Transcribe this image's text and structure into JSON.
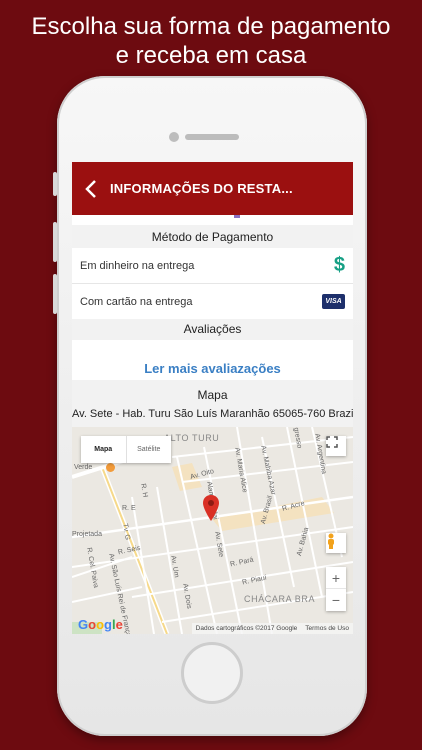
{
  "headline": {
    "line1": "Escolha sua forma de pagamento",
    "line2": "e receba em casa"
  },
  "appbar": {
    "title": "INFORMAÇÕES DO RESTA...",
    "back_icon": "chevron-left-icon",
    "color": "#9b1010"
  },
  "payment": {
    "title": "Método de Pagamento",
    "options": [
      {
        "label": "Em dinheiro na entrega",
        "icon": "dollar-icon",
        "glyph": "$"
      },
      {
        "label": "Com cartão na entrega",
        "icon": "visa-icon",
        "glyph": "VISA"
      }
    ]
  },
  "reviews": {
    "title": "Avaliações",
    "more_link": "Ler mais avaliazações"
  },
  "map_section": {
    "title": "Mapa",
    "address": "Av. Sete - Hab. Turu São Luís Maranhão 65065-760 Brazil",
    "toggle": {
      "map": "Mapa",
      "satellite": "Satélite"
    },
    "zoom": {
      "in": "+",
      "out": "−"
    },
    "google": "Google",
    "attribution": {
      "data": "Dados cartográficos ©2017 Google",
      "terms": "Termos de Uso"
    },
    "labels": {
      "alto_turu": "ALTO TURU",
      "chacara": "CHÁCARA BRA",
      "verde": "Verde",
      "projetada": "Projetada",
      "av_oito": "Av. Oito",
      "alameda_jai": "Alameda Jai",
      "av_maria_alice": "Av. Maria Alice",
      "av_mahiba": "Av. Mahiba Azar",
      "av_argentina": "Av. Argentina",
      "gresso": "gresso",
      "r_acre": "R. Acre",
      "av_sete": "Av. Sete",
      "av_brasil": "Av. Brasil",
      "av_bahia": "Av. Bahia",
      "r_para": "R. Pará",
      "r_piaui": "R. Piauí",
      "av_um": "Av. Um",
      "av_dois": "Av. Dois",
      "r_seis": "R. Seis",
      "r_e": "R. E",
      "r_h": "R. H",
      "tv_g": "Tv. G",
      "r_cel_paiva": "R. Cel. Paiva",
      "av_sao_luis": "Av. São Luís Rei de França"
    },
    "colors": {
      "pin": "#d93025",
      "water": "#a8cbe8",
      "highlight": "#f4e2c0"
    }
  }
}
